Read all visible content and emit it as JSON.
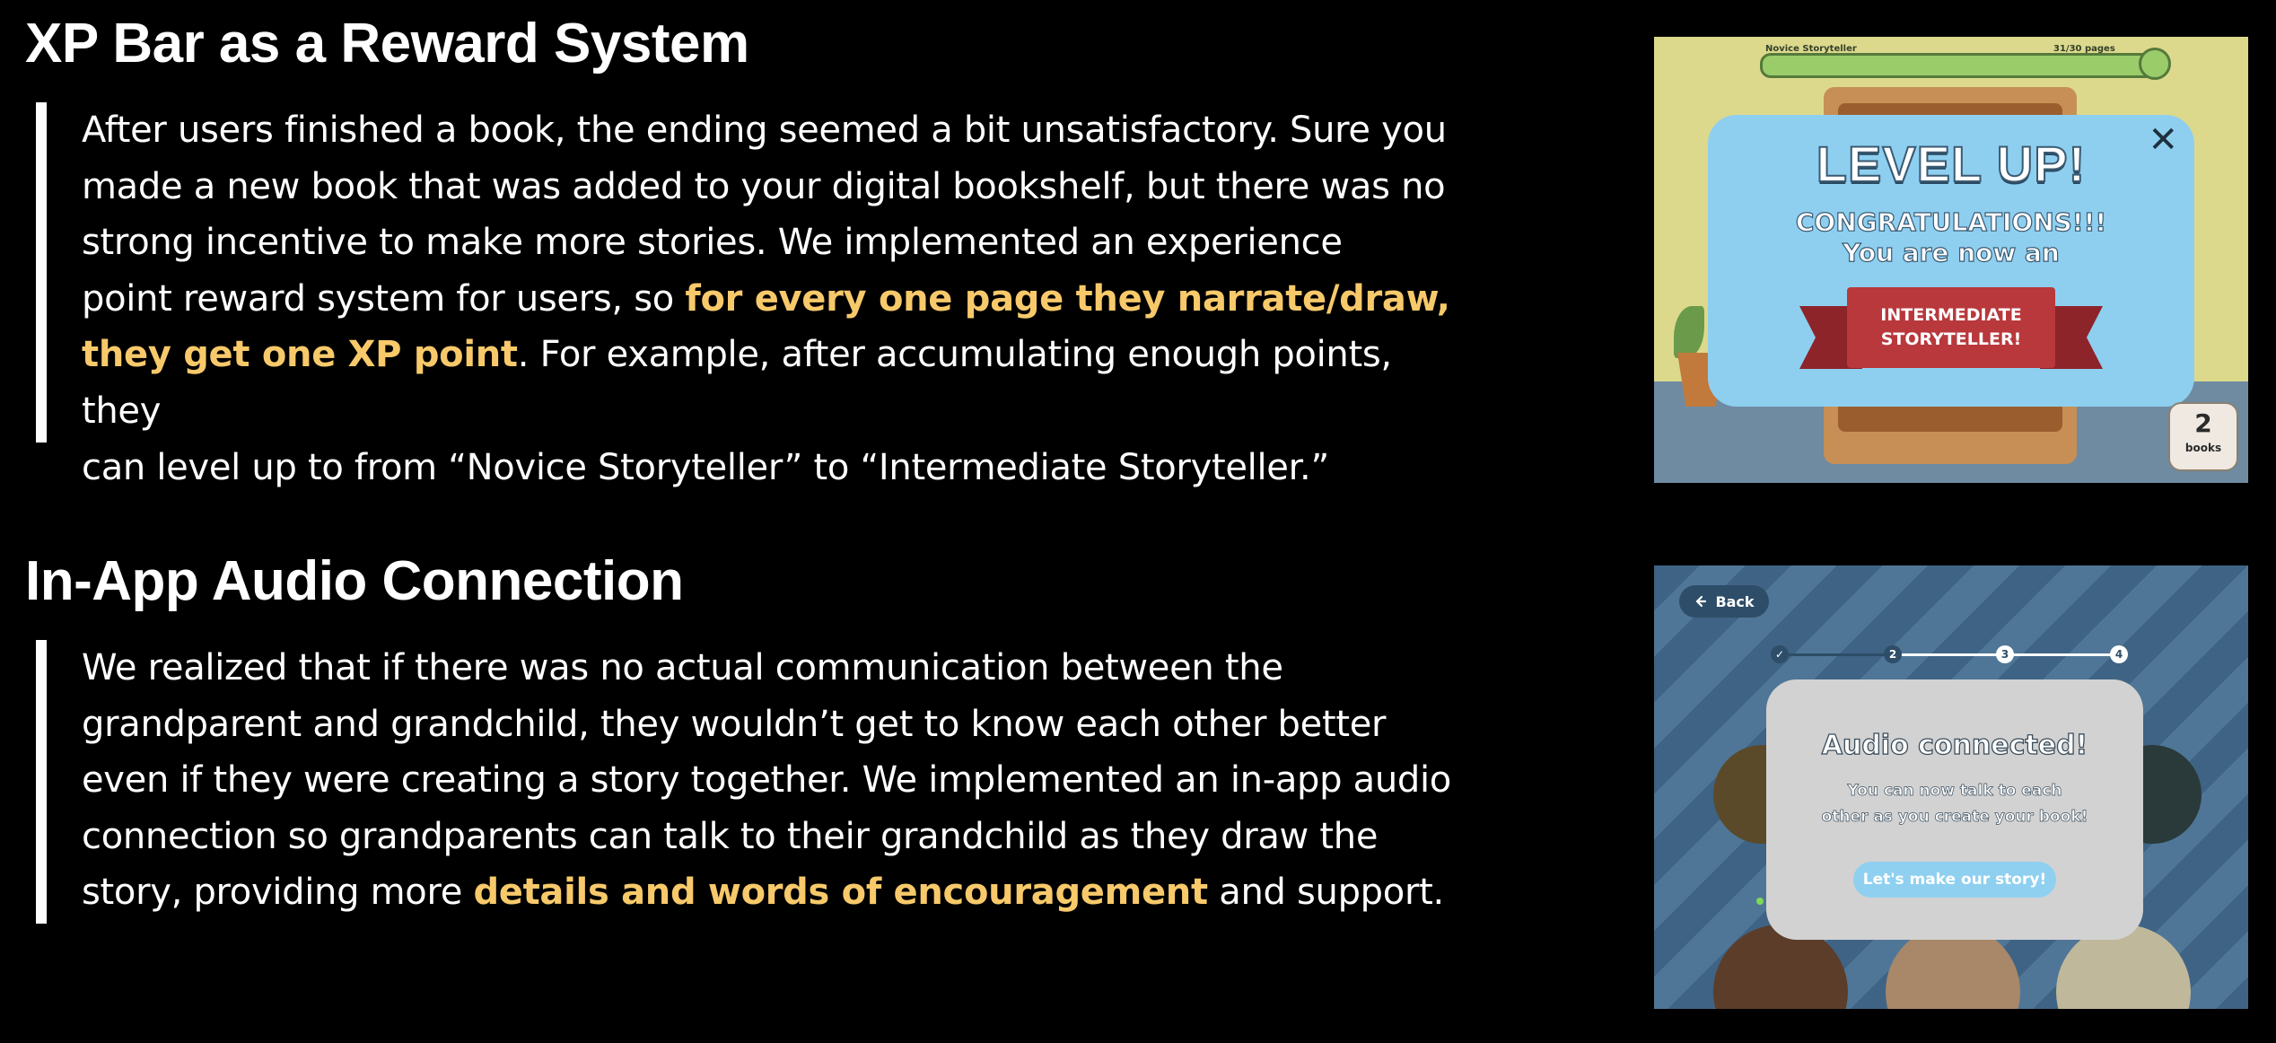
{
  "xp_section": {
    "title": "XP Bar as a Reward System",
    "p_lines": [
      "After users finished a book, the ending seemed a bit unsatisfactory. Sure you",
      "made a new book that was added to your digital bookshelf, but there was no",
      "strong incentive to make more stories. We implemented an experience"
    ],
    "p_line4_pre": "point reward system for users, so ",
    "p_line4_hl": "for every one page they narrate/draw,",
    "p_line5_hl": "they get one XP point",
    "p_line5_post": ". For example, after accumulating enough points, they",
    "p_line6": "can level up to from “Novice Storyteller” to “Intermediate Storyteller.”"
  },
  "audio_section": {
    "title": "In-App Audio Connection",
    "p_lines": [
      "We realized that if there was no actual communication between the",
      "grandparent and grandchild, they wouldn’t get to know each other better",
      "even if they were creating a story together. We implemented an in-app audio",
      "connection so grandparents can talk to their grandchild as they draw the"
    ],
    "p_line5_pre": "story, providing more ",
    "p_line5_hl": "details and words of encouragement",
    "p_line5_post": " and support."
  },
  "level_up_mockup": {
    "xp_label": "Novice Storyteller",
    "xp_count": "31/30 pages",
    "xp_progress": 1.0,
    "title": "LEVEL UP!",
    "close_glyph": "✕",
    "congrats": "CONGRATULATIONS!!!",
    "subtitle": "You are now an",
    "level_name": "INTERMEDIATE\nSTORYTELLER!",
    "books_count": "2",
    "books_label": "books"
  },
  "audio_mockup": {
    "back_label": "Back",
    "back_icon": "arrow-left-icon",
    "steps": [
      "✓",
      "2",
      "3",
      "4"
    ],
    "title": "Audio connected!",
    "body_line1": "You can now talk to each",
    "body_line2": "other as you create your book!",
    "cta": "Let's make our story!"
  },
  "colors": {
    "background": "#000000",
    "highlight": "#f7c96a",
    "modal_blue": "#8ecff0",
    "ribbon_red": "#b8383c",
    "audio_bg": "#3f6384"
  }
}
